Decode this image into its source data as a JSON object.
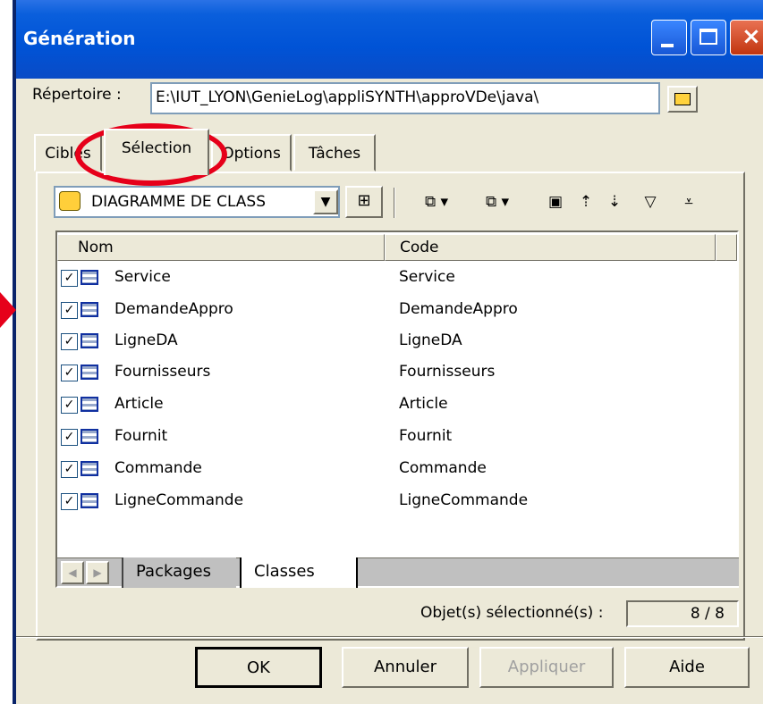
{
  "window": {
    "title": "Génération"
  },
  "repertoire": {
    "label": "Répertoire :",
    "value": "E:\\IUT_LYON\\GenieLog\\appliSYNTH\\approVDe\\java\\"
  },
  "tabs": [
    {
      "label": "Cibles"
    },
    {
      "label": "Sélection"
    },
    {
      "label": "Options"
    },
    {
      "label": "Tâches"
    }
  ],
  "toolbar": {
    "diagram_select": "DIAGRAMME DE CLASS"
  },
  "table": {
    "columns": [
      "Nom",
      "Code"
    ],
    "rows": [
      {
        "nom": "Service",
        "code": "Service"
      },
      {
        "nom": "DemandeAppro",
        "code": "DemandeAppro"
      },
      {
        "nom": "LigneDA",
        "code": "LigneDA"
      },
      {
        "nom": "Fournisseurs",
        "code": "Fournisseurs"
      },
      {
        "nom": "Article",
        "code": "Article"
      },
      {
        "nom": "Fournit",
        "code": "Fournit"
      },
      {
        "nom": "Commande",
        "code": "Commande"
      },
      {
        "nom": "LigneCommande",
        "code": "LigneCommande"
      }
    ]
  },
  "bottom_tabs": {
    "packages": "Packages",
    "classes": "Classes"
  },
  "status": {
    "label": "Objet(s) sélectionné(s) :",
    "value": "8 / 8"
  },
  "buttons": {
    "ok": "OK",
    "annuler": "Annuler",
    "appliquer": "Appliquer",
    "aide": "Aide"
  },
  "colors": {
    "titlebar": "#0053d6",
    "dialog_bg": "#ece9d8",
    "annotation": "#e6001a"
  }
}
